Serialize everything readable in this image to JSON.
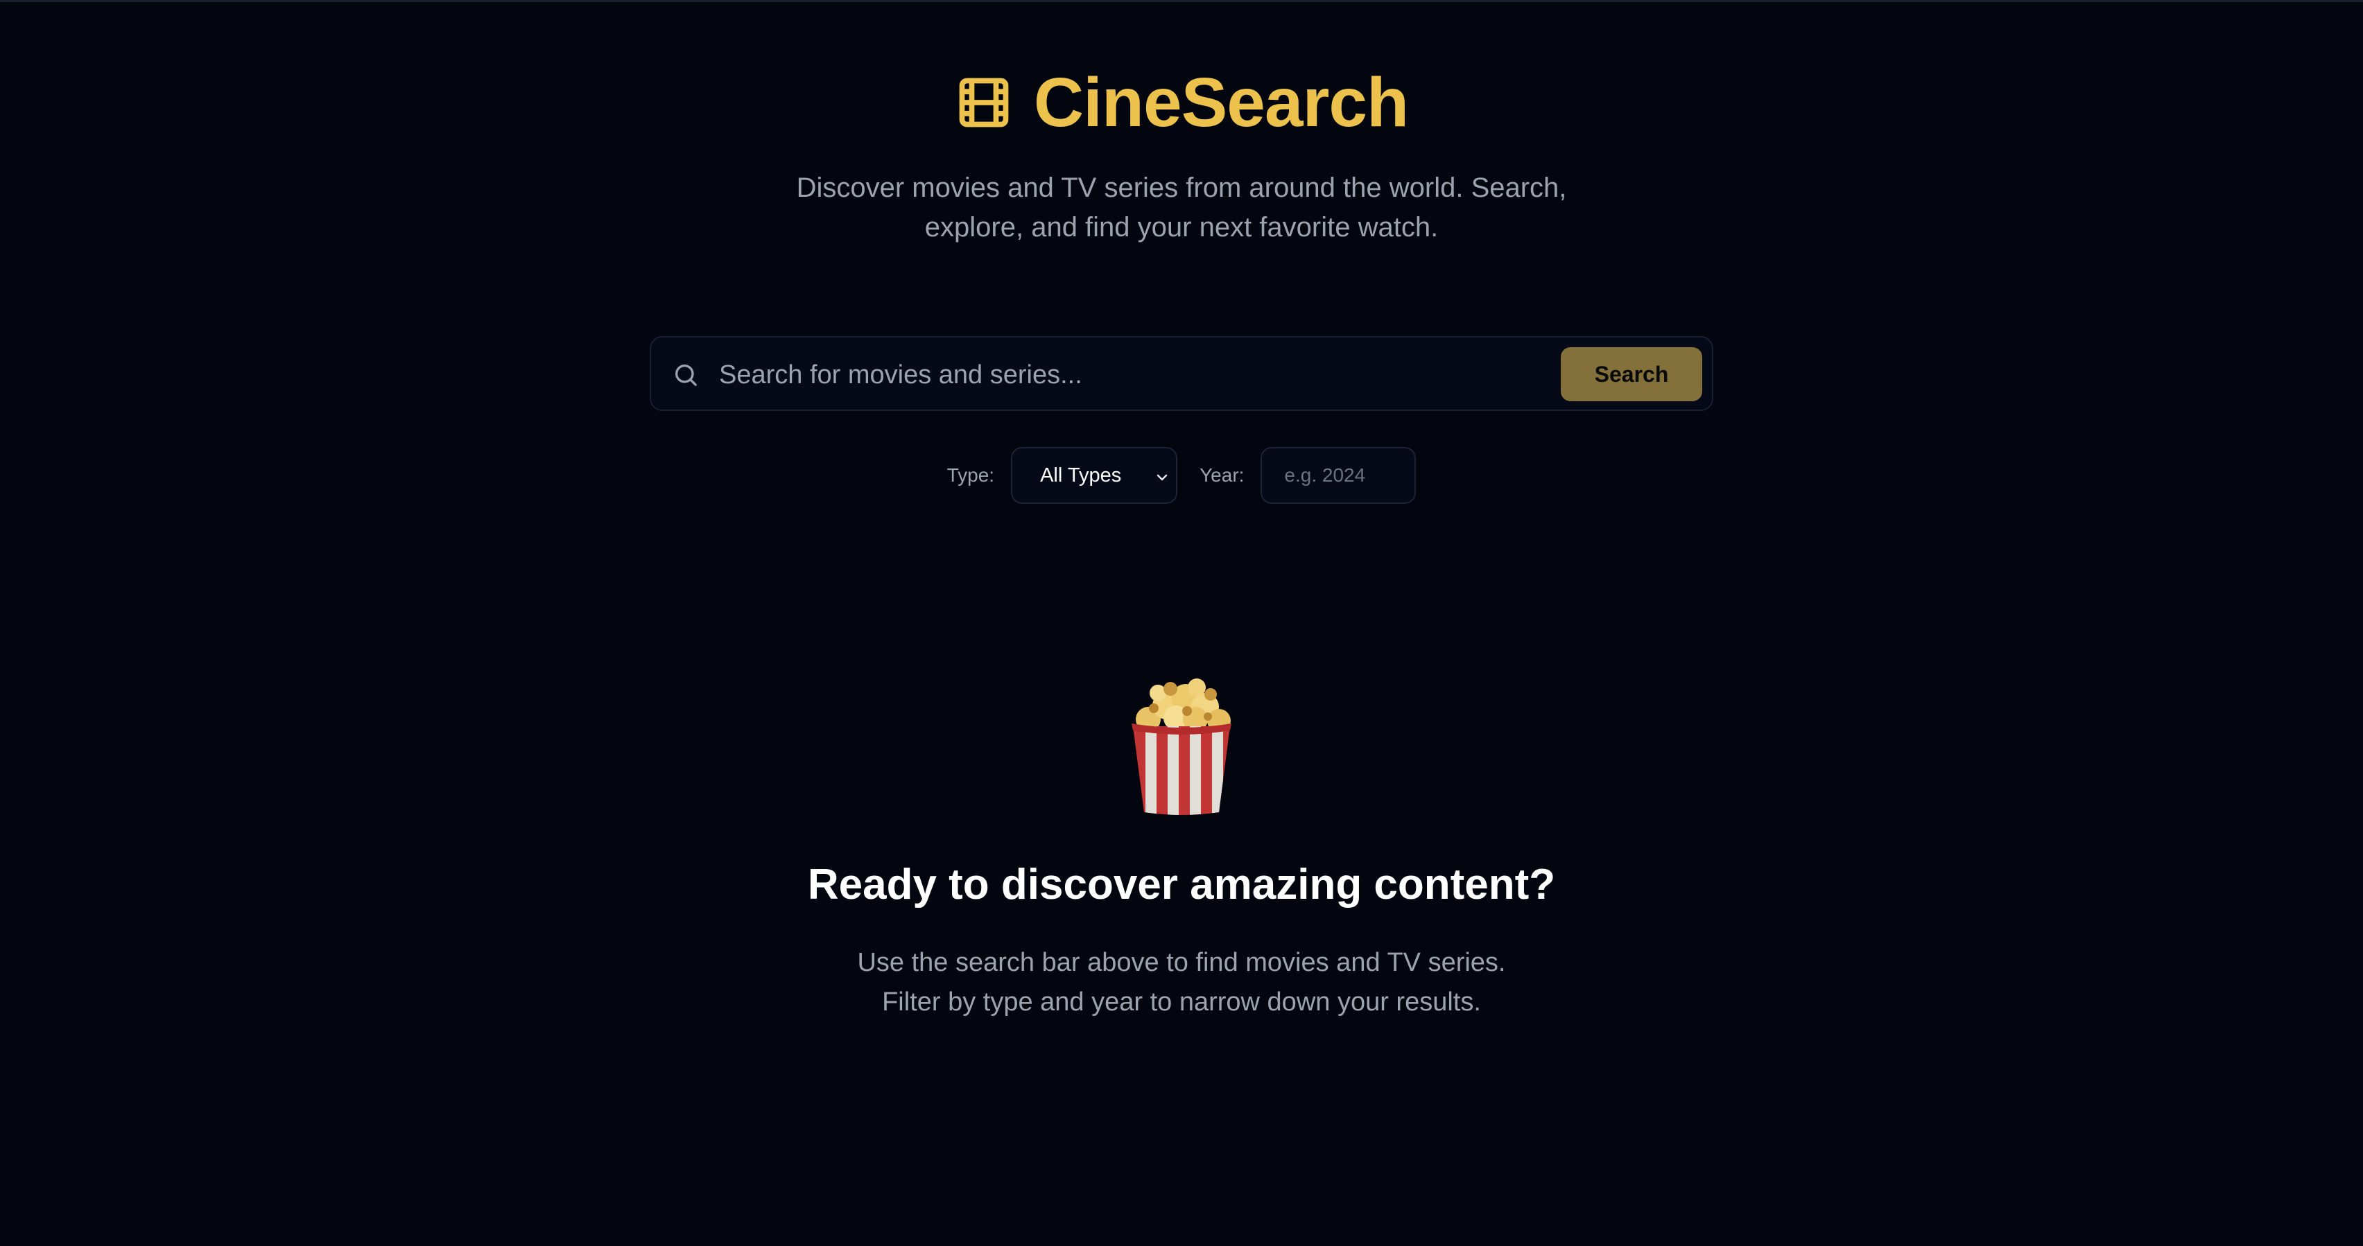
{
  "header": {
    "logo_icon": "film-icon",
    "title": "CineSearch",
    "tagline_line1": "Discover movies and TV series from around the world. Search,",
    "tagline_line2": "explore, and find your next favorite watch."
  },
  "search": {
    "icon": "search-icon",
    "placeholder": "Search for movies and series...",
    "value": "",
    "button_label": "Search"
  },
  "filters": {
    "type_label": "Type:",
    "type_selected": "All Types",
    "year_label": "Year:",
    "year_placeholder": "e.g. 2024",
    "year_value": ""
  },
  "empty_state": {
    "icon": "popcorn-icon",
    "title": "Ready to discover amazing content?",
    "description_line1": "Use the search bar above to find movies and TV series.",
    "description_line2": "Filter by type and year to narrow down your results."
  },
  "colors": {
    "background": "#03060f",
    "accent": "#ecc14c",
    "search_button": "#83703a",
    "muted_text": "#9ca3af"
  }
}
